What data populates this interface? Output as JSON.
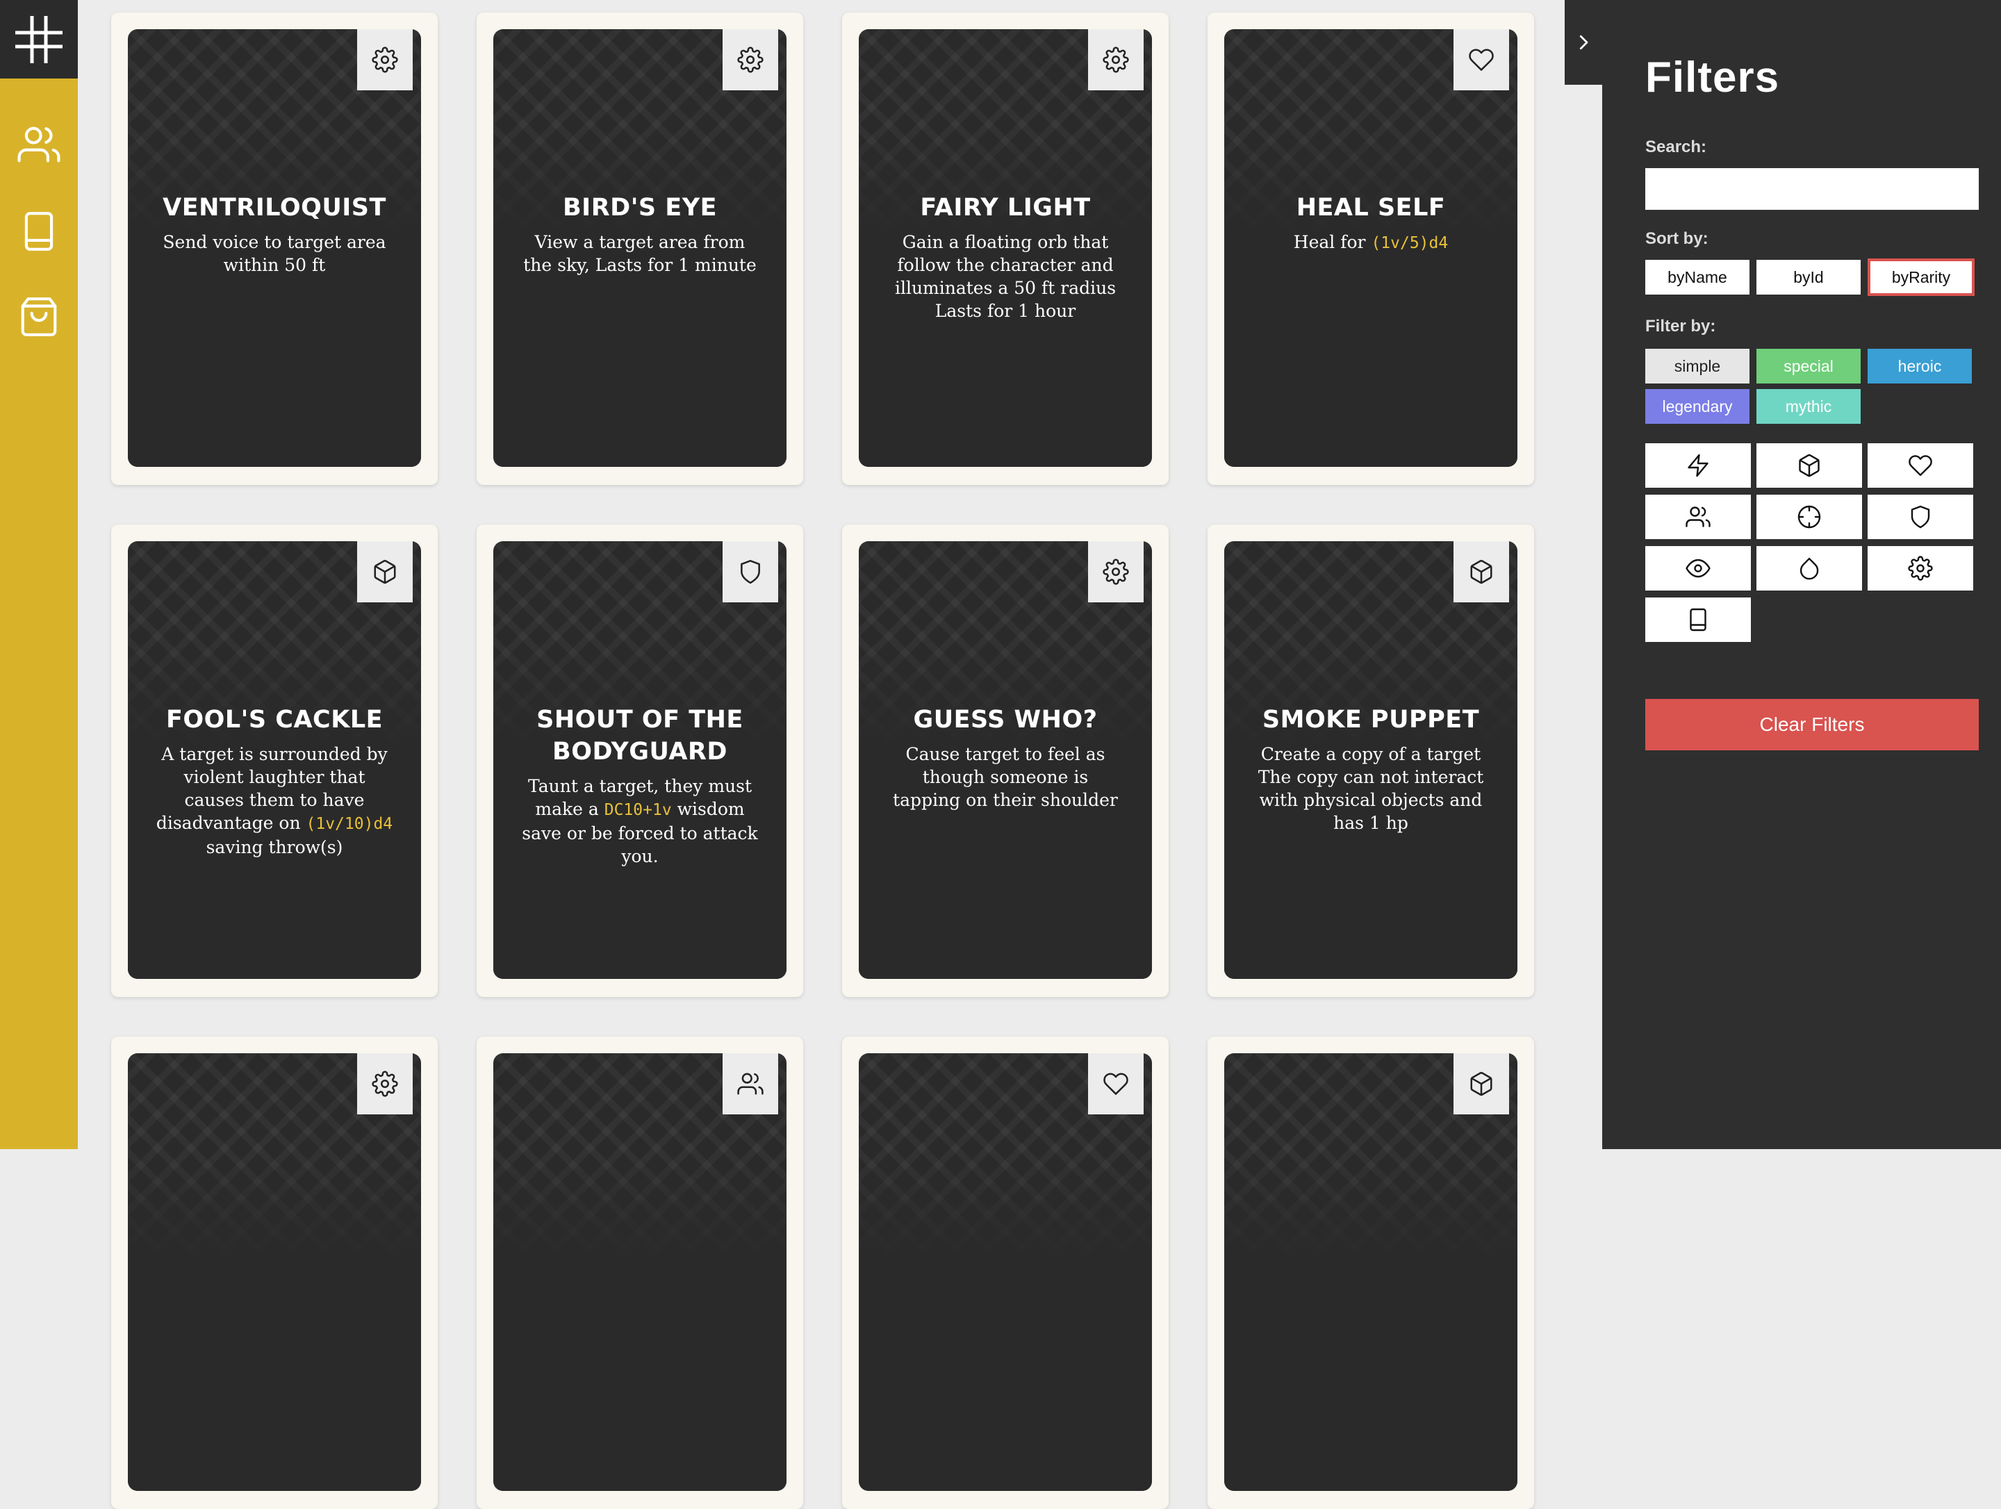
{
  "sidebar": {
    "items": [
      {
        "icon": "plus-grid-logo-icon"
      },
      {
        "icon": "users-icon"
      },
      {
        "icon": "book-icon"
      },
      {
        "icon": "shopping-bag-icon"
      }
    ]
  },
  "cards": [
    {
      "title": "VENTRILOQUIST",
      "desc": "Send voice to target area within 50 ft",
      "icon": "gear-icon"
    },
    {
      "title": "BIRD'S EYE",
      "desc": "View a target area from the sky, Lasts for 1 minute",
      "icon": "gear-icon"
    },
    {
      "title": "FAIRY LIGHT",
      "desc": "Gain a floating orb that follow the character and illuminates a 50 ft radius Lasts for 1 hour",
      "icon": "gear-icon"
    },
    {
      "title": "HEAL SELF",
      "desc_before": "Heal for ",
      "desc_code": "(1v/5)d4",
      "desc_after": "",
      "icon": "heart-icon"
    },
    {
      "title": "FOOL'S CACKLE",
      "desc_before": "A target is surrounded by violent laughter that causes them to have disadvantage on ",
      "desc_code": "(1v/10)d4",
      "desc_after": " saving throw(s)",
      "icon": "cube-icon"
    },
    {
      "title": "SHOUT OF THE BODYGUARD",
      "desc_before": "Taunt a target, they must make a ",
      "desc_code": "DC10+1v",
      "desc_after": " wisdom save or be forced to attack you.",
      "icon": "shield-icon"
    },
    {
      "title": "GUESS WHO?",
      "desc": "Cause target to feel as though someone is tapping on their shoulder",
      "icon": "gear-icon"
    },
    {
      "title": "SMOKE PUPPET",
      "desc": "Create a copy of a target The copy can not interact with physical objects and has 1 hp",
      "icon": "cube-icon"
    },
    {
      "title": "",
      "icon": "gear-icon"
    },
    {
      "title": "",
      "icon": "users-icon"
    },
    {
      "title": "",
      "icon": "heart-icon"
    },
    {
      "title": "",
      "icon": "cube-icon"
    }
  ],
  "filters": {
    "title": "Filters",
    "search_label": "Search:",
    "search_value": "",
    "sort_label": "Sort by:",
    "sort_options": [
      "byName",
      "byId",
      "byRarity"
    ],
    "sort_active": "byRarity",
    "filter_label": "Filter by:",
    "rarities": [
      {
        "label": "simple",
        "color": "#e6e6e6",
        "text": "#222222"
      },
      {
        "label": "special",
        "color": "#6fcf7a",
        "text": "#ffffff"
      },
      {
        "label": "heroic",
        "color": "#3a9fd4",
        "text": "#ffffff"
      },
      {
        "label": "legendary",
        "color": "#7b7ee6",
        "text": "#ffffff"
      },
      {
        "label": "mythic",
        "color": "#6fd6c4",
        "text": "#ffffff"
      }
    ],
    "type_icons": [
      "lightning-icon",
      "cube-icon",
      "heart-icon",
      "users-icon",
      "crosshair-icon",
      "shield-icon",
      "eye-icon",
      "droplet-icon",
      "gear-icon",
      "book-icon"
    ],
    "clear_label": "Clear Filters"
  },
  "colors": {
    "accent": "#d8b32a",
    "panel": "#2f2f2f",
    "danger": "#d9534f",
    "code": "#e8c13a"
  }
}
